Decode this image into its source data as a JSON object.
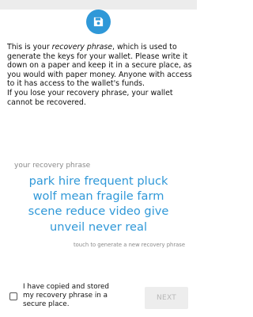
{
  "icons": {
    "badge": "save-floppy-icon"
  },
  "colors": {
    "accent": "#2f98d8",
    "muted": "#8a8a8a",
    "button_disabled_bg": "#ededed",
    "button_disabled_text": "#b8b8b8"
  },
  "intro": {
    "part1": "This is your ",
    "emphasis": "recovery phrase",
    "part2": ", which is used to generate the keys for your wallet. Please write it down on a paper and keep it in a secure place, as you would with paper money. Anyone with access to it has access to the wallet's funds.",
    "warning": "If you lose your recovery phrase, your wallet cannot be recovered."
  },
  "phrase": {
    "label": "your recovery phrase",
    "lines": [
      "park hire frequent pluck",
      "wolf mean fragile farm",
      "scene reduce video give",
      "unveil never real"
    ],
    "hint": "touch to generate a new recovery phrase"
  },
  "confirm": {
    "checked": false,
    "label": "I have copied and stored my recovery phrase in a secure place."
  },
  "next_button": {
    "label": "NEXT",
    "enabled": false
  }
}
